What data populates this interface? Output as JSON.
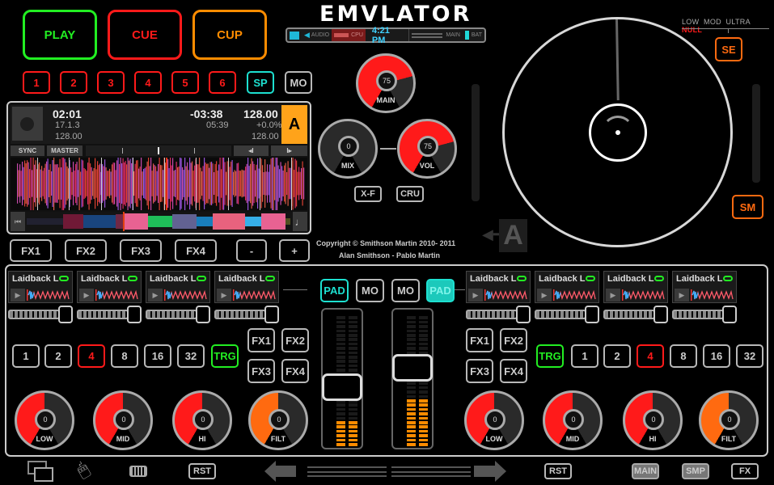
{
  "app": {
    "logo_text": "EMVLATOR"
  },
  "transport": {
    "play": "PLAY",
    "cue": "CUE",
    "cup": "CUP"
  },
  "hotcues": [
    "1",
    "2",
    "3",
    "4",
    "5",
    "6"
  ],
  "hotcue_extra": {
    "sp": "SP",
    "mo": "MO"
  },
  "statusbar": {
    "audio": "AUDIO",
    "cpu": "CPU",
    "time": "4:21 PM",
    "main": "MAIN",
    "bat": "BAT"
  },
  "deck": {
    "elapsed": "02:01",
    "beat_pos": "17.1.3",
    "bpm_original": "128.00",
    "remaining": "-03:38",
    "duration": "05:39",
    "tempo": "128.00",
    "pitch": "+0.0%",
    "tempo_base": "128.00",
    "letter": "A",
    "sync": "SYNC",
    "master": "MASTER",
    "nudge_back": "◂I",
    "nudge_fwd": "I▸",
    "colors": {
      "deck_accent": "#ffa31a"
    }
  },
  "deck_fx": [
    "FX1",
    "FX2",
    "FX3",
    "FX4"
  ],
  "deck_pm": {
    "minus": "-",
    "plus": "+"
  },
  "mixer": {
    "main_knob": {
      "label": "MAIN",
      "value": "75",
      "fraction": 0.75
    },
    "mix_knob": {
      "label": "MIX",
      "value": "0",
      "fraction": 0.0
    },
    "vol_knob": {
      "label": "VOL",
      "value": "75",
      "fraction": 0.75
    },
    "xf": "X-F",
    "cru": "CRU"
  },
  "copyright": {
    "line1": "Copyright © Smithson Martin  2010- 2011",
    "line2": "Alan Smithson - Pablo Martin"
  },
  "turntable": {
    "quality_modes": [
      "LOW",
      "MOD",
      "ULTRA",
      "NULL"
    ],
    "active_mode": "NULL",
    "se": "SE",
    "sm": "SM",
    "deck_assign": "A"
  },
  "sampler_left": [
    {
      "name": "Laidback L",
      "level": 0.85
    },
    {
      "name": "Laidback L",
      "level": 0.85
    },
    {
      "name": "Laidback L",
      "level": 0.85
    },
    {
      "name": "Laidback L",
      "level": 0.85
    }
  ],
  "sampler_right": [
    {
      "name": "Laidback L",
      "level": 0.85
    },
    {
      "name": "Laidback L",
      "level": 0.85
    },
    {
      "name": "Laidback L",
      "level": 0.85
    },
    {
      "name": "Laidback L",
      "level": 0.85
    }
  ],
  "loops_left": [
    "1",
    "2",
    "4",
    "8",
    "16",
    "32"
  ],
  "loops_right": [
    "1",
    "2",
    "4",
    "8",
    "16",
    "32"
  ],
  "loop_active": "4",
  "trg": "TRG",
  "fx_left": [
    "FX1",
    "FX2",
    "FX3",
    "FX4"
  ],
  "fx_right": [
    "FX1",
    "FX2",
    "FX3",
    "FX4"
  ],
  "channel_left": {
    "pad": "PAD",
    "mo": "MO",
    "fader_level": 0.42,
    "meter_level": 0.2
  },
  "channel_right": {
    "pad": "PAD",
    "mo": "MO",
    "fader_level": 0.6,
    "meter_level": 0.35
  },
  "eq_left": [
    {
      "label": "LOW",
      "value": "0",
      "fraction": 0.5,
      "color": "#ff1a1a"
    },
    {
      "label": "MID",
      "value": "0",
      "fraction": 0.5,
      "color": "#ff1a1a"
    },
    {
      "label": "HI",
      "value": "0",
      "fraction": 0.5,
      "color": "#ff1a1a"
    },
    {
      "label": "FILT",
      "value": "0",
      "fraction": 0.5,
      "color": "#ff6a10"
    }
  ],
  "eq_right": [
    {
      "label": "LOW",
      "value": "0",
      "fraction": 0.5,
      "color": "#ff1a1a"
    },
    {
      "label": "MID",
      "value": "0",
      "fraction": 0.5,
      "color": "#ff1a1a"
    },
    {
      "label": "HI",
      "value": "0",
      "fraction": 0.5,
      "color": "#ff1a1a"
    },
    {
      "label": "FILT",
      "value": "0",
      "fraction": 0.5,
      "color": "#ff6a10"
    }
  ],
  "bottombar": {
    "rst_left": "RST",
    "rst_right": "RST",
    "main": "MAIN",
    "smp": "SMP",
    "fx": "FX"
  }
}
